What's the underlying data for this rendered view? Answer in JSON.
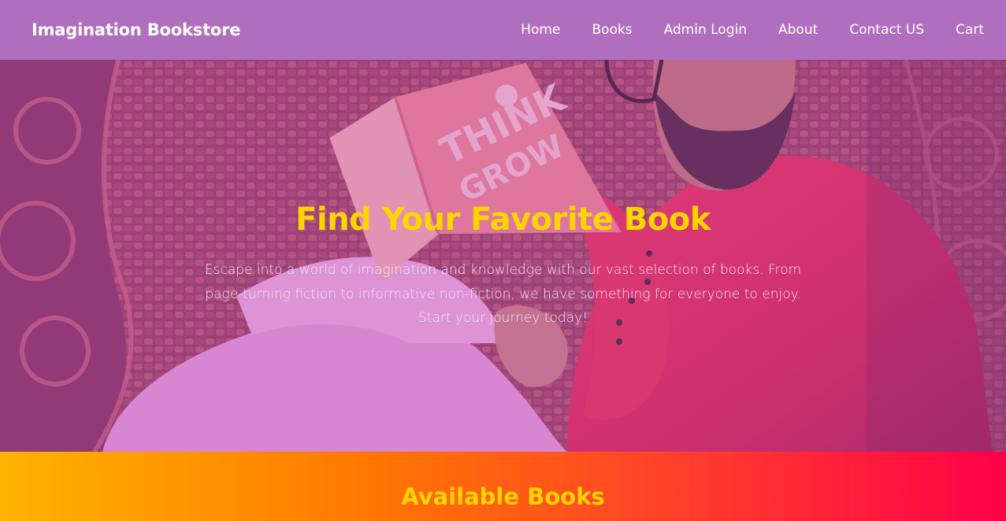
{
  "navbar": {
    "brand": "Imagination Bookstore",
    "links": [
      "Home",
      "Books",
      "Admin Login",
      "About",
      "Contact US",
      "Cart"
    ],
    "background_color": "#b06fbe"
  },
  "hero": {
    "title": "Find Your Favorite Book",
    "text": "Escape into a world of imagination and knowledge with our vast selection of books. From page-turning fiction to informative non-fiction, we have something for everyone to enjoy. Start your journey today!",
    "title_color": "#ffd400",
    "background_image": "photo of a man in a red shirt reading a book in a wicker chair"
  },
  "books_section": {
    "heading": "Available Books",
    "heading_color": "#ffd400"
  }
}
